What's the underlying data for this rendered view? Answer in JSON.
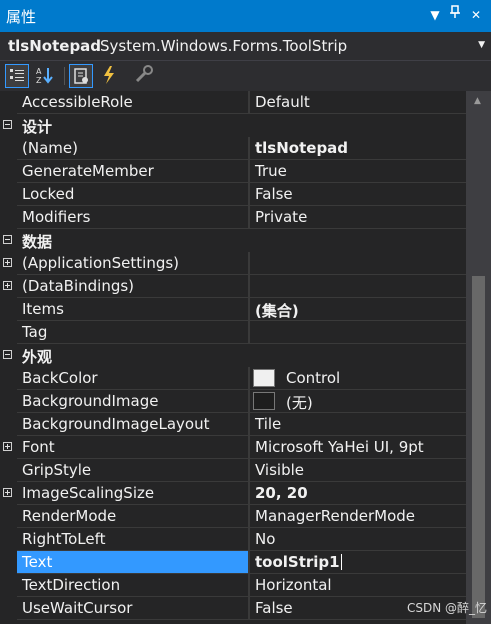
{
  "window": {
    "title": "属性",
    "pin_glyph": "▼",
    "dock_glyph": "ᛩ",
    "close_glyph": "✕"
  },
  "object": {
    "name": "tlsNotepad",
    "type": "System.Windows.Forms.ToolStrip",
    "dropdown_glyph": "▼"
  },
  "toolbar": {
    "buttons": [
      "categorized-icon",
      "alphabetical-icon",
      "properties-icon",
      "events-icon",
      "property-pages-icon"
    ]
  },
  "rows": [
    {
      "kind": "prop",
      "name": "AccessibleRole",
      "value": "Default"
    },
    {
      "kind": "cat",
      "name": "设计",
      "box": "minus"
    },
    {
      "kind": "prop",
      "name": "(Name)",
      "value": "tlsNotepad",
      "bold": true
    },
    {
      "kind": "prop",
      "name": "GenerateMember",
      "value": "True"
    },
    {
      "kind": "prop",
      "name": "Locked",
      "value": "False"
    },
    {
      "kind": "prop",
      "name": "Modifiers",
      "value": "Private"
    },
    {
      "kind": "cat",
      "name": "数据",
      "box": "minus"
    },
    {
      "kind": "prop",
      "name": "(ApplicationSettings)",
      "value": "",
      "expand": true
    },
    {
      "kind": "prop",
      "name": "(DataBindings)",
      "value": "",
      "expand": true
    },
    {
      "kind": "prop",
      "name": "Items",
      "value": "(集合)",
      "bold": true
    },
    {
      "kind": "prop",
      "name": "Tag",
      "value": ""
    },
    {
      "kind": "cat",
      "name": "外观",
      "box": "minus"
    },
    {
      "kind": "prop",
      "name": "BackColor",
      "value": "Control",
      "swatch": "#f0f0f0"
    },
    {
      "kind": "prop",
      "name": "BackgroundImage",
      "value": "(无)",
      "swatch": "#1e1e1e"
    },
    {
      "kind": "prop",
      "name": "BackgroundImageLayout",
      "value": "Tile"
    },
    {
      "kind": "prop",
      "name": "Font",
      "value": "Microsoft YaHei UI, 9pt",
      "expand": true
    },
    {
      "kind": "prop",
      "name": "GripStyle",
      "value": "Visible"
    },
    {
      "kind": "prop",
      "name": "ImageScalingSize",
      "value": "20, 20",
      "bold": true,
      "expand": true
    },
    {
      "kind": "prop",
      "name": "RenderMode",
      "value": "ManagerRenderMode"
    },
    {
      "kind": "prop",
      "name": "RightToLeft",
      "value": "No"
    },
    {
      "kind": "prop",
      "name": "Text",
      "value": "toolStrip1",
      "bold": true,
      "selected": true,
      "editing": true
    },
    {
      "kind": "prop",
      "name": "TextDirection",
      "value": "Horizontal"
    },
    {
      "kind": "prop",
      "name": "UseWaitCursor",
      "value": "False"
    }
  ],
  "scrollbar": {
    "up_glyph": "▲"
  },
  "watermark": "CSDN @醉_忆",
  "colors": {
    "accent": "#007acc",
    "selection": "#3399ff",
    "background": "#252526"
  }
}
